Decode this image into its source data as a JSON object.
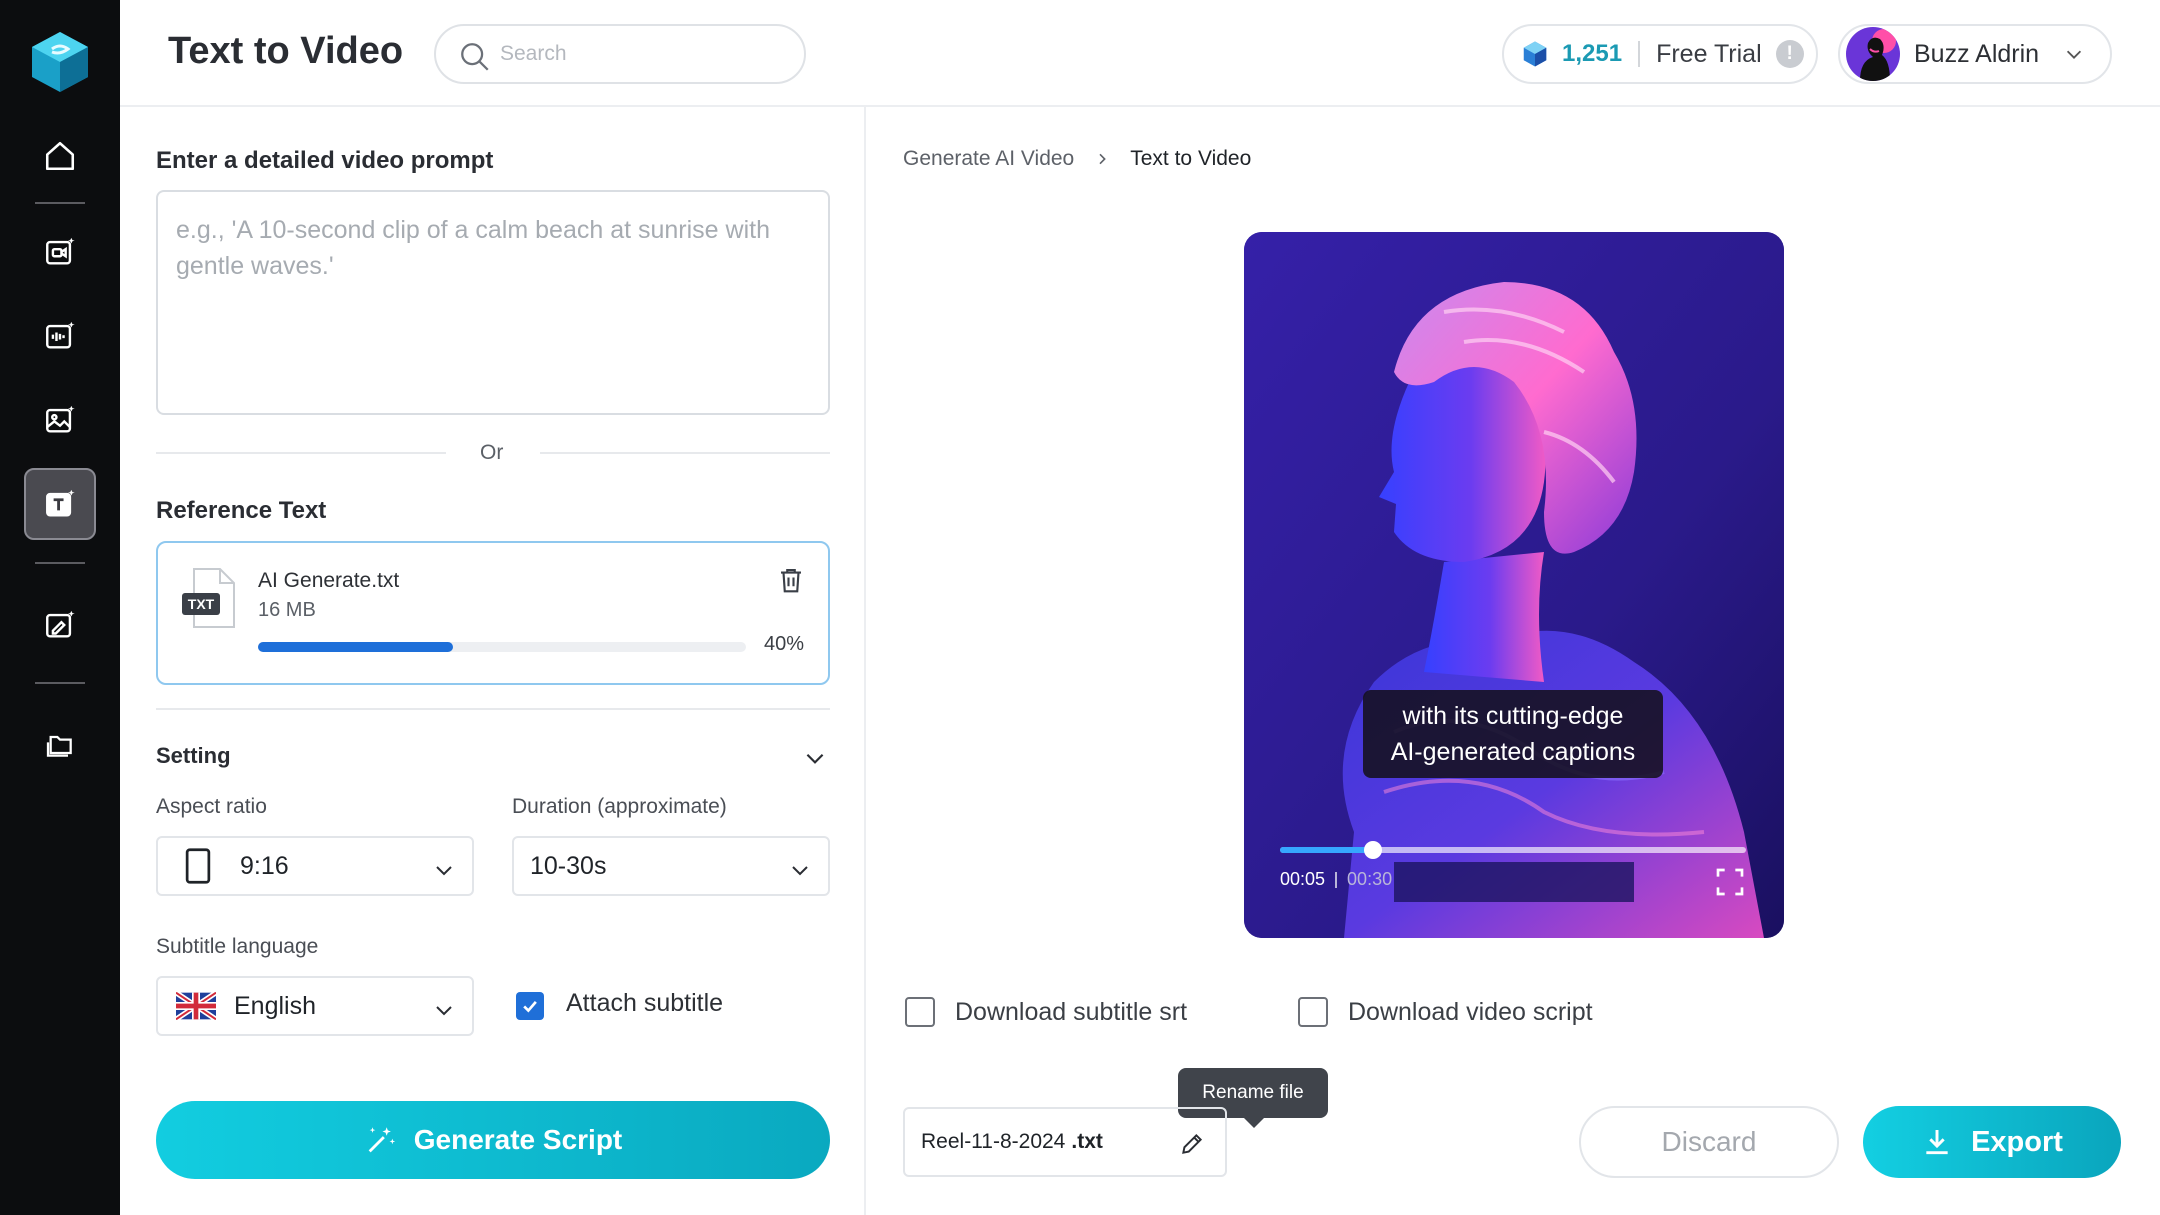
{
  "header": {
    "title": "Text to Video",
    "search_placeholder": "Search",
    "credits": "1,251",
    "plan": "Free Trial",
    "info_glyph": "!",
    "user_name": "Buzz Aldrin"
  },
  "sidebar": {
    "items": [
      {
        "name": "home",
        "icon": "home-icon"
      },
      {
        "name": "video-ai",
        "icon": "video-sparkle-icon"
      },
      {
        "name": "audio-ai",
        "icon": "audio-wave-sparkle-icon"
      },
      {
        "name": "image-ai",
        "icon": "image-sparkle-icon"
      },
      {
        "name": "text-to-video",
        "icon": "text-sparkle-icon",
        "active": true
      },
      {
        "name": "image-edit",
        "icon": "image-edit-sparkle-icon"
      },
      {
        "name": "projects",
        "icon": "folder-icon"
      }
    ]
  },
  "prompt": {
    "label": "Enter a detailed video prompt",
    "placeholder": "e.g., 'A 10-second clip of a calm beach at sunrise with gentle waves.'",
    "value": ""
  },
  "or_text": "Or",
  "reference": {
    "label": "Reference Text",
    "file_badge": "TXT",
    "file_name": "AI Generate.txt",
    "file_size": "16 MB",
    "progress": 40,
    "progress_label": "40%"
  },
  "settings": {
    "title": "Setting",
    "aspect_label": "Aspect ratio",
    "aspect_value": "9:16",
    "duration_label": "Duration (approximate)",
    "duration_value": "10-30s",
    "subtitle_label": "Subtitle language",
    "language_value": "English",
    "attach_subtitle_label": "Attach subtitle",
    "attach_subtitle_checked": true
  },
  "generate_button": "Generate Script",
  "breadcrumb": {
    "parent": "Generate AI Video",
    "current": "Text to Video"
  },
  "video": {
    "caption_line1": "with its cutting-edge",
    "caption_line2": "AI-generated captions",
    "current_time": "00:05",
    "duration": "00:30",
    "progress": 0.2
  },
  "downloads": {
    "subtitle_srt": "Download subtitle srt",
    "video_script": "Download video script"
  },
  "rename": {
    "tooltip": "Rename file",
    "file_base": "Reel-11-8-2024",
    "file_ext": ".txt"
  },
  "actions": {
    "discard": "Discard",
    "export": "Export"
  },
  "colors": {
    "accent": "#12c3d8",
    "progress_blue": "#1e6fd9",
    "rail_bg": "#0c0d0f",
    "credits_text": "#1b9ab3"
  }
}
